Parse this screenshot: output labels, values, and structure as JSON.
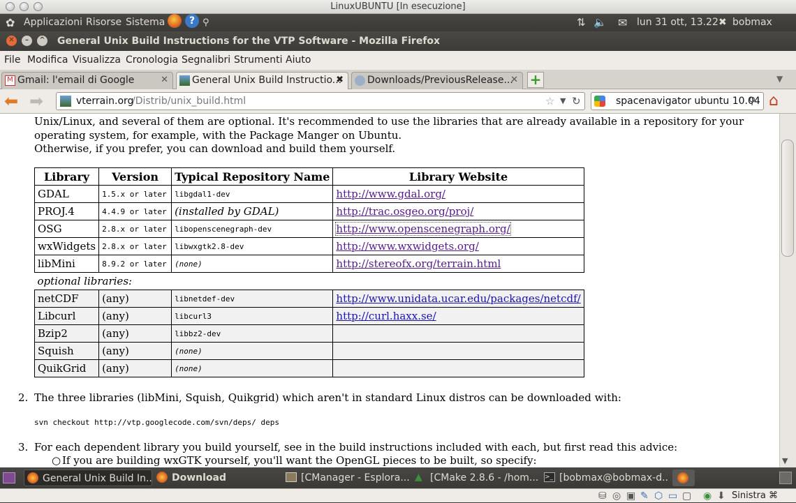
{
  "vm": {
    "title": "LinuxUBUNTU [In esecuzione]"
  },
  "panel": {
    "applications": "Applicazioni",
    "places": "Risorse",
    "system": "Sistema",
    "datetime": "lun 31 ott, 13.22",
    "user": "bobmax"
  },
  "window": {
    "title": "General Unix Build Instructions for the VTP Software - Mozilla Firefox"
  },
  "menu": [
    "File",
    "Modifica",
    "Visualizza",
    "Cronologia",
    "Segnalibri",
    "Strumenti",
    "Aiuto"
  ],
  "tabs": [
    {
      "label": "Gmail: l'email di Google"
    },
    {
      "label": "General Unix Build Instructio..."
    },
    {
      "label": "Downloads/PreviousRelease..."
    }
  ],
  "nav": {
    "url_domain": "vterrain.org",
    "url_path": "/Distrib/unix_build.html",
    "search_value": "spacenavigator ubuntu 10.04"
  },
  "page": {
    "intro": [
      "Unix/Linux, and several of them are optional.   It's recommended to use the libraries that are already available in a repository for your",
      "operating system, for example, with the Package Manger on Ubuntu.",
      "Otherwise, if you prefer, you can download and build them yourself."
    ],
    "table_headers": [
      "Library",
      "Version",
      "Typical Repository Name",
      "Library Website"
    ],
    "required_rows": [
      {
        "lib": "GDAL",
        "ver": "1.5.x or later",
        "repo": "libgdal1-dev",
        "site": "http://www.gdal.org/"
      },
      {
        "lib": "PROJ.4",
        "ver": "4.4.9 or later",
        "repo": "(installed by GDAL)",
        "site": "http://trac.osgeo.org/proj/"
      },
      {
        "lib": "OSG",
        "ver": "2.8.x or later",
        "repo": "libopenscenegraph-dev",
        "site": "http://www.openscenegraph.org/"
      },
      {
        "lib": "wxWidgets",
        "ver": "2.8.x or later",
        "repo": "libwxgtk2.8-dev",
        "site": "http://www.wxwidgets.org/"
      },
      {
        "lib": "libMini",
        "ver": "8.9.2 or later",
        "repo": "(none)",
        "site": "http://stereofx.org/terrain.html"
      }
    ],
    "optional_label": "optional libraries:",
    "optional_rows": [
      {
        "lib": "netCDF",
        "ver": "(any)",
        "repo": "libnetdef-dev",
        "site": "http://www.unidata.ucar.edu/packages/netcdf/"
      },
      {
        "lib": "Libcurl",
        "ver": "(any)",
        "repo": "libcurl3",
        "site": "http://curl.haxx.se/"
      },
      {
        "lib": "Bzip2",
        "ver": "(any)",
        "repo": "libbz2-dev",
        "site": ""
      },
      {
        "lib": "Squish",
        "ver": "(any)",
        "repo": "(none)",
        "site": ""
      },
      {
        "lib": "QuikGrid",
        "ver": "(any)",
        "repo": "(none)",
        "site": ""
      }
    ],
    "step2_num": "2.",
    "step2": "The three libraries (libMini, Squish, Quikgrid) which aren't in standard Linux distros can be downloaded with:",
    "svn_cmd": "svn checkout http://vtp.googlecode.com/svn/deps/ deps",
    "step3_num": "3.",
    "step3": "For each dependent library you build yourself, see in the build instructions included with each, but first read this advice:",
    "bullet1": "If you are building wxGTK yourself, you'll want the OpenGL pieces to be built, so specify:"
  },
  "taskbar": [
    {
      "label": "General Unix Build In..."
    },
    {
      "label": "Download"
    },
    {
      "label": "[CManager - Esplora..."
    },
    {
      "label": "[CMake 2.8.6 - /hom..."
    },
    {
      "label": "[bobmax@bobmax-d..."
    }
  ],
  "status": {
    "keyboard": "Sinistra ⌘"
  },
  "colors": {
    "panel": "#3c3b37",
    "link": "#1a13b0",
    "page_bg": "#ffffff",
    "chrome": "#efebe7"
  }
}
